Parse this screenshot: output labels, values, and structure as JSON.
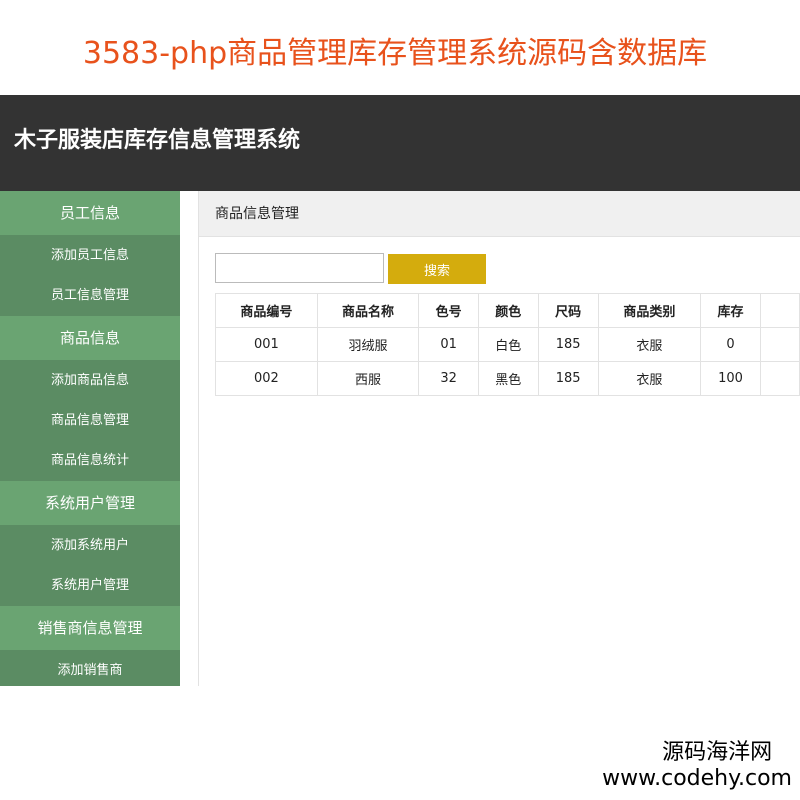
{
  "banner": {
    "title": "3583-php商品管理库存管理系统源码含数据库"
  },
  "app": {
    "title": "木子服装店库存信息管理系统"
  },
  "sidebar": {
    "sections": [
      {
        "label": "员工信息",
        "items": [
          "添加员工信息",
          "员工信息管理"
        ]
      },
      {
        "label": "商品信息",
        "items": [
          "添加商品信息",
          "商品信息管理",
          "商品信息统计"
        ]
      },
      {
        "label": "系统用户管理",
        "items": [
          "添加系统用户",
          "系统用户管理"
        ]
      },
      {
        "label": "销售商信息管理",
        "items": [
          "添加销售商"
        ]
      }
    ]
  },
  "main": {
    "header": "商品信息管理",
    "search": {
      "value": "",
      "placeholder": "",
      "button_label": "搜索"
    },
    "table": {
      "columns": [
        "商品编号",
        "商品名称",
        "色号",
        "颜色",
        "尺码",
        "商品类别",
        "库存",
        ""
      ],
      "rows": [
        [
          "001",
          "羽绒服",
          "01",
          "白色",
          "185",
          "衣服",
          "0",
          ""
        ],
        [
          "002",
          "西服",
          "32",
          "黑色",
          "185",
          "衣服",
          "100",
          ""
        ]
      ]
    }
  },
  "watermark": {
    "name": "源码海洋网",
    "url": "www.codehy.com"
  },
  "colors": {
    "banner_title": "#e8521c",
    "header_bg": "#333333",
    "sidebar_group": "#6aa472",
    "sidebar_item": "#5b8c63",
    "search_button": "#d4ac0d"
  }
}
